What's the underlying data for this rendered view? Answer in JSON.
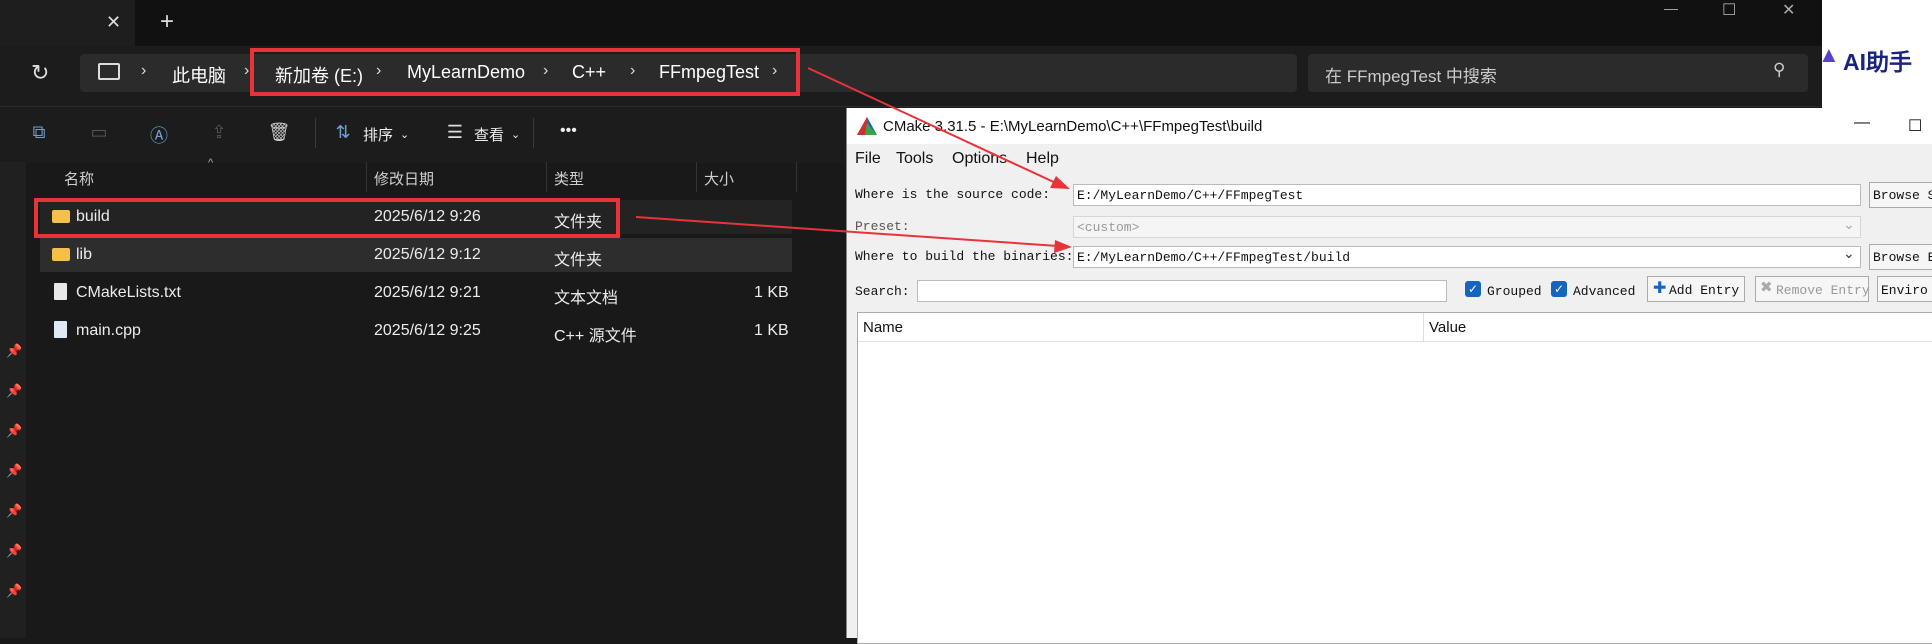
{
  "tabbar": {
    "close": "✕",
    "add": "+"
  },
  "window_controls": {
    "minimize": "—",
    "maximize": "☐",
    "close": "✕"
  },
  "address": {
    "refresh": "↻",
    "crumbs": [
      "此电脑",
      "新加卷 (E:)",
      "MyLearnDemo",
      "C++",
      "FFmpegTest"
    ],
    "search_placeholder": "在 FFmpegTest 中搜索"
  },
  "ai_assistant": {
    "label": "AI助手"
  },
  "toolbar": {
    "sort_label": "排序",
    "view_label": "查看",
    "more": "•••"
  },
  "columns": {
    "name": "名称",
    "date": "修改日期",
    "type": "类型",
    "size": "大小"
  },
  "files": [
    {
      "name": "build",
      "date": "2025/6/12 9:26",
      "type": "文件夹",
      "size": "",
      "icon": "folder-icon"
    },
    {
      "name": "lib",
      "date": "2025/6/12 9:12",
      "type": "文件夹",
      "size": "",
      "icon": "folder-icon"
    },
    {
      "name": "CMakeLists.txt",
      "date": "2025/6/12 9:21",
      "type": "文本文档",
      "size": "1 KB",
      "icon": "text-file-icon"
    },
    {
      "name": "main.cpp",
      "date": "2025/6/12 9:25",
      "type": "C++ 源文件",
      "size": "1 KB",
      "icon": "cpp-file-icon"
    }
  ],
  "cmake": {
    "title": "CMake 3.31.5 - E:\\MyLearnDemo\\C++\\FFmpegTest\\build",
    "menu": [
      "File",
      "Tools",
      "Options",
      "Help"
    ],
    "source_label": "Where is the source code:",
    "source_value": "E:/MyLearnDemo/C++/FFmpegTest",
    "browse_source": "Browse So",
    "preset_label": "Preset:",
    "preset_value": "<custom>",
    "build_label": "Where to build the binaries:",
    "build_value": "E:/MyLearnDemo/C++/FFmpegTest/build",
    "browse_build": "Browse B",
    "search_label": "Search:",
    "grouped": "Grouped",
    "advanced": "Advanced",
    "add_entry": "Add Entry",
    "remove_entry": "Remove Entry",
    "environment": "Enviro",
    "table_name": "Name",
    "table_value": "Value"
  },
  "colors": {
    "highlight": "#e8333a",
    "explorer_bg": "#191919",
    "cmake_bg": "#f0f0f0"
  }
}
